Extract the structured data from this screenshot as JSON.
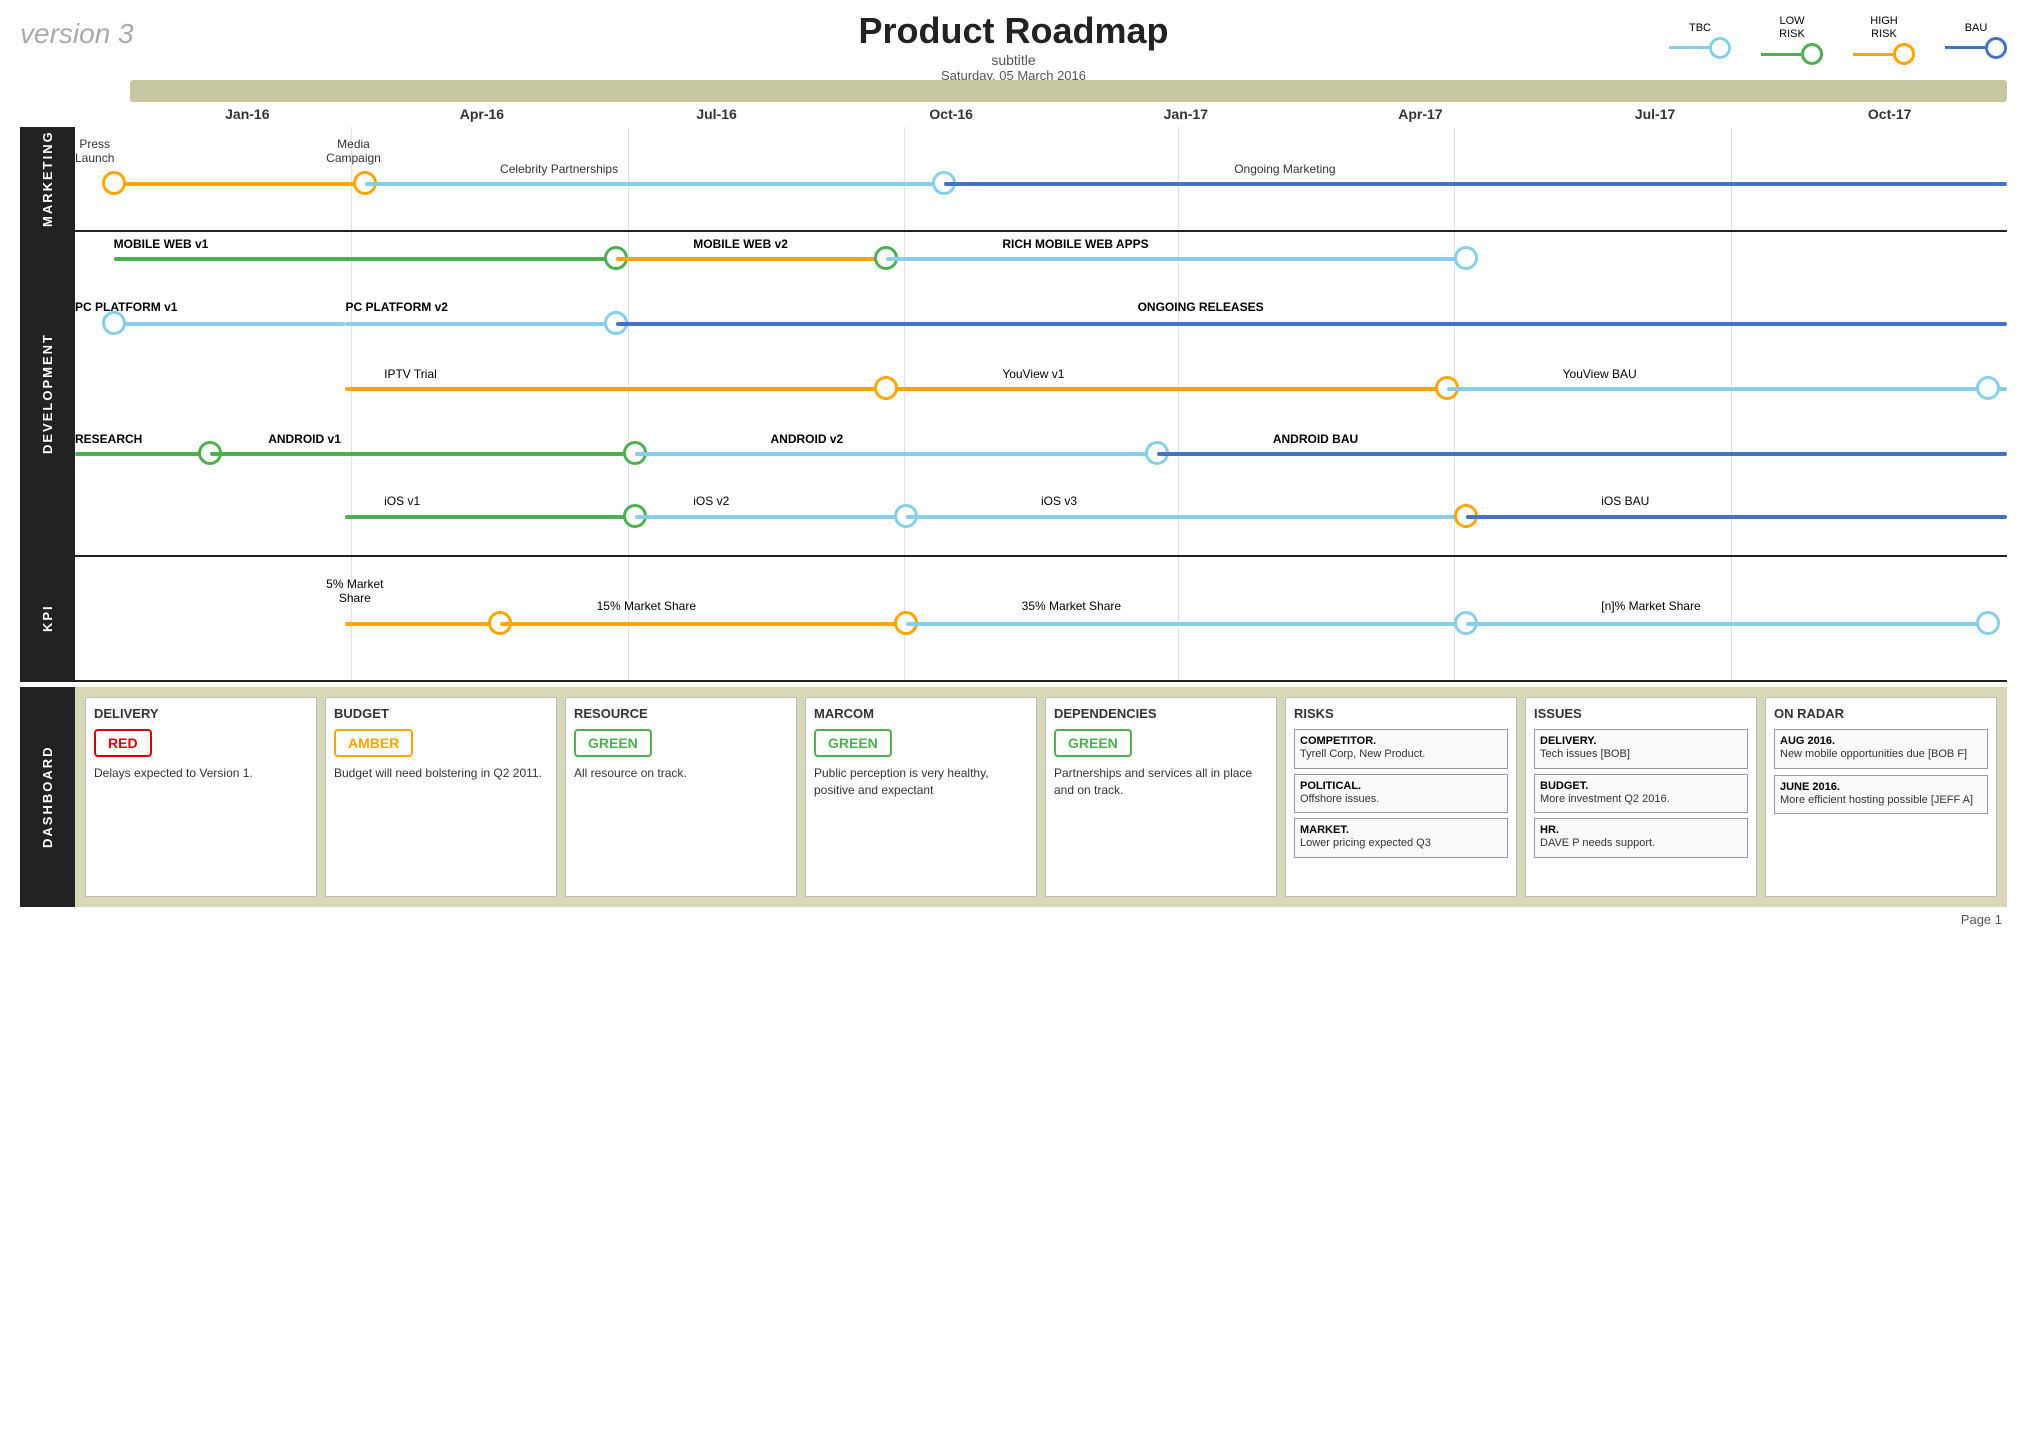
{
  "header": {
    "version": "version 3",
    "title": "Product Roadmap",
    "subtitle": "subtitle",
    "date": "Saturday, 05 March 2016"
  },
  "legend": {
    "items": [
      {
        "id": "tbc",
        "label": "TBC",
        "color": "#87CEEB"
      },
      {
        "id": "low-risk",
        "label": "LOW\nRISK",
        "color": "#4CAF50"
      },
      {
        "id": "high-risk",
        "label": "HIGH\nRISK",
        "color": "#FFA500"
      },
      {
        "id": "bau",
        "label": "BAU",
        "color": "#4472C4"
      }
    ]
  },
  "timeline": {
    "labels": [
      "Jan-16",
      "Apr-16",
      "Jul-16",
      "Oct-16",
      "Jan-17",
      "Apr-17",
      "Jul-17",
      "Oct-17"
    ]
  },
  "sections": {
    "marketing": {
      "label": "MARKETING",
      "lanes": [
        {
          "id": "marketing-1",
          "label": "Press\nLaunch",
          "label2": "Media\nCampaign",
          "label3": "Celebrity Partnerships",
          "label4": "Ongoing Marketing"
        }
      ]
    },
    "development": {
      "label": "DEVELOPMENT",
      "lanes": [
        {
          "id": "mobile-web",
          "label": "MOBILE WEB v1",
          "label2": "MOBILE WEB v2",
          "label3": "RICH MOBILE WEB APPS"
        },
        {
          "id": "pc-platform",
          "label": "PC PLATFORM v1",
          "label2": "PC PLATFORM v2",
          "label3": "ONGOING RELEASES"
        },
        {
          "id": "iptv",
          "label": "IPTV Trial",
          "label2": "YouView v1",
          "label3": "YouView BAU"
        },
        {
          "id": "android",
          "label": "RESEARCH",
          "label2": "ANDROID v1",
          "label3": "ANDROID v2",
          "label4": "ANDROID BAU"
        },
        {
          "id": "ios",
          "label": "iOS v1",
          "label2": "iOS v2",
          "label3": "iOS v3",
          "label4": "iOS BAU"
        }
      ]
    },
    "kpi": {
      "label": "KPI",
      "lanes": [
        {
          "id": "kpi-1",
          "label": "5% Market\nShare",
          "label2": "15% Market Share",
          "label3": "35% Market Share",
          "label4": "[n]% Market Share"
        }
      ]
    }
  },
  "dashboard": {
    "label": "DASHBOARD",
    "cards": [
      {
        "id": "delivery",
        "title": "DELIVERY",
        "status": "RED",
        "status_type": "red",
        "body": "Delays expected to Version 1."
      },
      {
        "id": "budget",
        "title": "BUDGET",
        "status": "AMBER",
        "status_type": "amber",
        "body": "Budget will need bolstering in Q2 2011."
      },
      {
        "id": "resource",
        "title": "RESOURCE",
        "status": "GREEN",
        "status_type": "green",
        "body": "All resource on track."
      },
      {
        "id": "marcom",
        "title": "MARCOM",
        "status": "GREEN",
        "status_type": "green",
        "body": "Public perception is very healthy, positive and expectant"
      },
      {
        "id": "dependencies",
        "title": "DEPENDENCIES",
        "status": "GREEN",
        "status_type": "green",
        "body": "Partnerships and services all in place and on track."
      },
      {
        "id": "risks",
        "title": "RISKS",
        "items": [
          {
            "label": "COMPETITOR.",
            "body": "Tyrell Corp, New Product."
          },
          {
            "label": "POLITICAL.",
            "body": "Offshore issues."
          },
          {
            "label": "MARKET.",
            "body": "Lower pricing expected Q3"
          }
        ]
      },
      {
        "id": "issues",
        "title": "ISSUES",
        "items": [
          {
            "label": "DELIVERY.",
            "body": "Tech issues [BOB]"
          },
          {
            "label": "BUDGET.",
            "body": "More investment Q2 2016."
          },
          {
            "label": "HR.",
            "body": "DAVE P needs support."
          }
        ]
      },
      {
        "id": "on-radar",
        "title": "ON RADAR",
        "items": [
          {
            "date": "AUG 2016.",
            "body": "New mobile opportunities due [BOB F]"
          },
          {
            "date": "JUNE 2016.",
            "body": "More efficient hosting possible [JEFF A]"
          }
        ]
      }
    ]
  },
  "footer": {
    "page": "Page 1"
  }
}
